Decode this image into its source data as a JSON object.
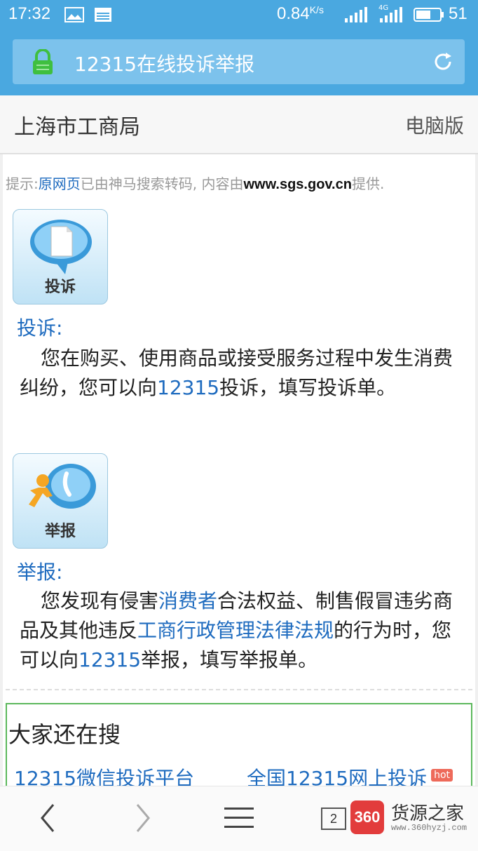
{
  "status": {
    "time": "17:32",
    "speed": "0.84",
    "speed_unit": "K/s",
    "network": "4G",
    "battery": "51"
  },
  "browser": {
    "page_title": "12315在线投诉举报"
  },
  "site": {
    "name": "上海市工商局",
    "desktop_version": "电脑版"
  },
  "tip": {
    "prefix": "提示:",
    "original_link": "原网页",
    "middle": "已由神马搜索转码, 内容由",
    "domain": "www.sgs.gov.cn",
    "suffix": "提供."
  },
  "complaint": {
    "icon_caption": "投诉",
    "title": "投诉:",
    "body_1": "您在购买、使用商品或接受服务过程中发生消费纠纷，您可以向",
    "body_link": "12315",
    "body_2": "投诉，填写投诉单。"
  },
  "report": {
    "icon_caption": "举报",
    "title": "举报:",
    "body_1": "您发现有侵害",
    "link_1": "消费者",
    "body_2": "合法权益、制售假冒违劣商品及其他违反",
    "link_2": "工商行政管理法律法规",
    "body_3": "的行为时，您可以向",
    "link_3": "12315",
    "body_4": "举报，填写举报单。"
  },
  "related": {
    "heading": "大家还在搜",
    "items": [
      {
        "label": "12315微信投诉平台"
      },
      {
        "label": "全国12315网上投诉",
        "badge": "hot"
      }
    ]
  },
  "bottom": {
    "tab_count": "2"
  },
  "watermark": {
    "logo": "360",
    "name": "货源之家",
    "url": "www.360hyzj.com"
  },
  "colors": {
    "bar": "#4aa8e0",
    "link": "#1e6bbf",
    "green_border": "#5cb85c",
    "hot_badge": "#ee6a5a"
  }
}
